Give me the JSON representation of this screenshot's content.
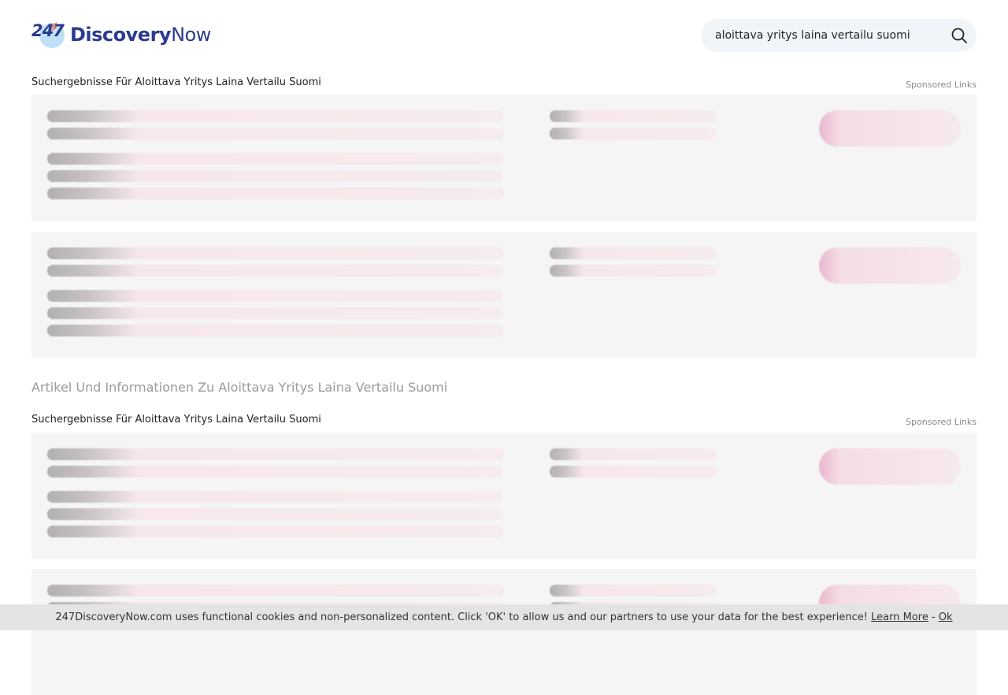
{
  "logo": {
    "number": "247",
    "word_bold": "Discovery",
    "word_regular": "Now"
  },
  "search": {
    "value": "aloittava yritys laina vertailu suomi",
    "icon": "search-icon"
  },
  "sections": [
    {
      "title": "Suchergebnisse Für Aloittava Yritys Laina Vertailu Suomi",
      "sponsored": "Sponsored Links"
    },
    {
      "title": "Suchergebnisse Für Aloittava Yritys Laina Vertailu Suomi",
      "sponsored": "Sponsored Links"
    }
  ],
  "article_heading": "Artikel Und Informationen Zu Aloittava Yritys Laina Vertailu Suomi",
  "cookie": {
    "text": "247DiscoveryNow.com uses functional cookies and non-personalized content. Click 'OK' to allow us and our partners to use your data for the best experience!",
    "learn_more": "Learn More",
    "separator": "-",
    "ok": "Ok"
  }
}
